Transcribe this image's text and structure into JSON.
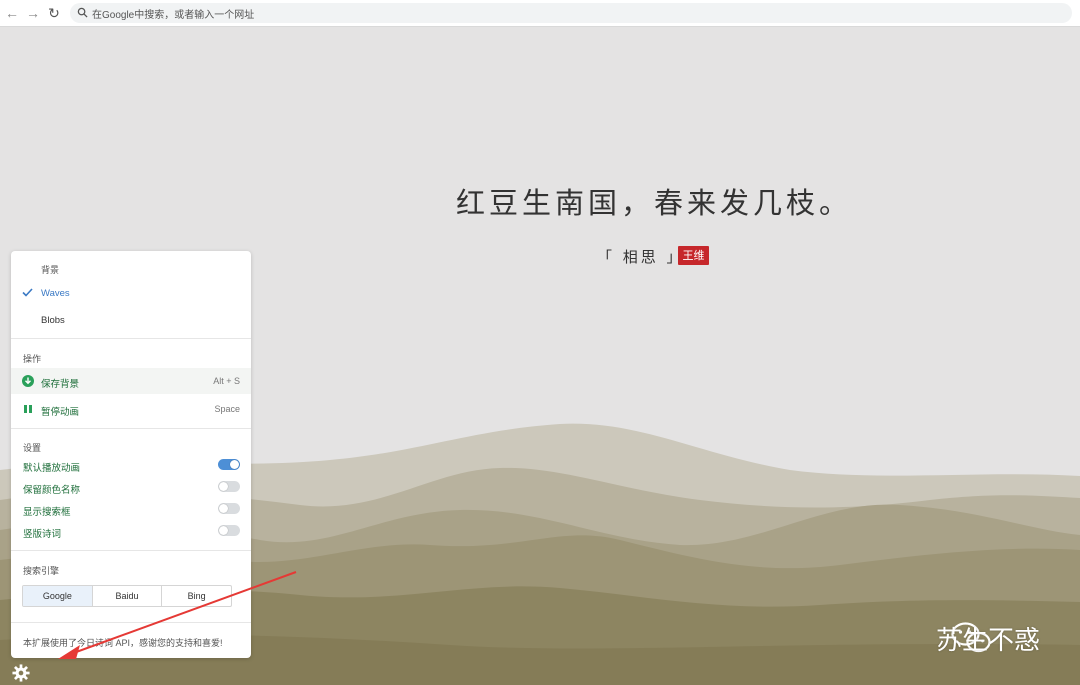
{
  "browser": {
    "address_placeholder": "在Google中搜索，或者输入一个网址"
  },
  "poem": {
    "line": "红豆生南国，春来发几枝。",
    "title": "「 相思 」",
    "author": "王维"
  },
  "panel": {
    "background_header": "背景",
    "background_options": [
      {
        "label": "Waves",
        "selected": true
      },
      {
        "label": "Blobs",
        "selected": false
      }
    ],
    "actions_header": "操作",
    "actions": [
      {
        "label": "保存背景",
        "shortcut": "Alt + S",
        "icon": "download-icon"
      },
      {
        "label": "暂停动画",
        "shortcut": "Space",
        "icon": "pause-icon"
      }
    ],
    "settings_header": "设置",
    "settings": [
      {
        "label": "默认播放动画",
        "on": true
      },
      {
        "label": "保留颜色名称",
        "on": false
      },
      {
        "label": "显示搜索框",
        "on": false
      },
      {
        "label": "竖版诗词",
        "on": false
      }
    ],
    "search_header": "搜索引擎",
    "engines": [
      {
        "label": "Google",
        "active": true
      },
      {
        "label": "Baidu",
        "active": false
      },
      {
        "label": "Bing",
        "active": false
      }
    ],
    "footer": "本扩展使用了今日诗词 API，感谢您的支持和喜爱!"
  },
  "watermark": {
    "text": "苏生不惑"
  },
  "colors": {
    "accent": "#4d8fd6",
    "seal": "#c6272b",
    "green": "#2aa05a"
  }
}
